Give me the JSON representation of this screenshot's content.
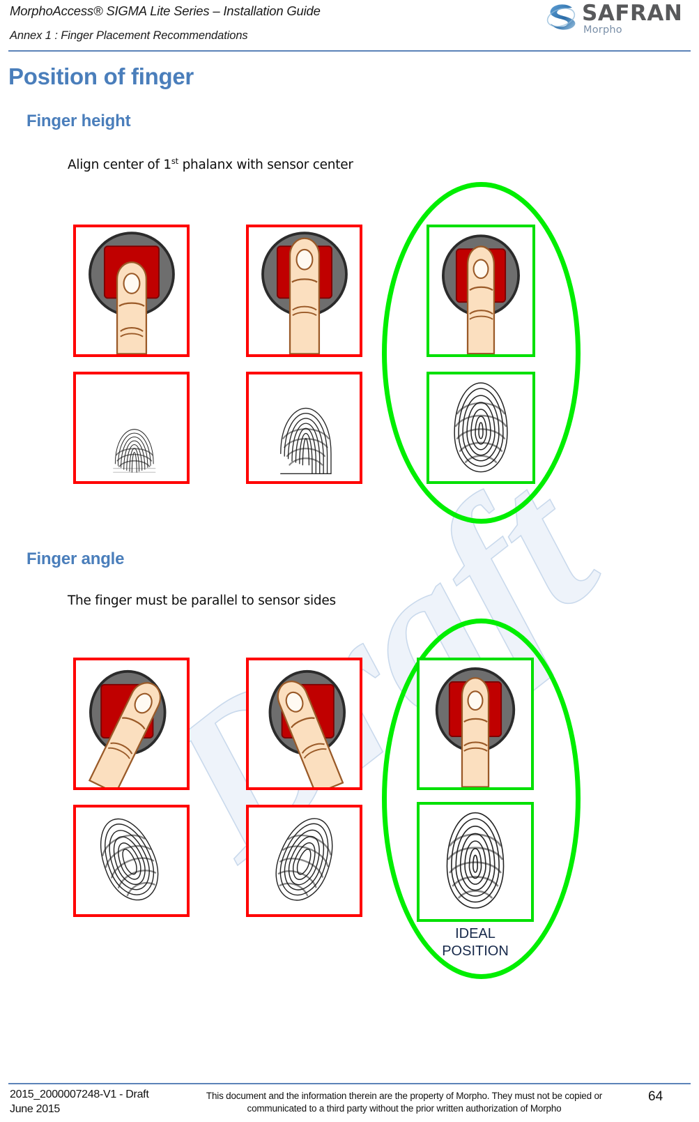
{
  "header": {
    "title": "MorphoAccess® SIGMA Lite Series – Installation Guide",
    "subtitle": "Annex 1 :  Finger Placement Recommendations",
    "logo_word": "SAFRAN",
    "logo_sub": "Morpho"
  },
  "watermark": {
    "text": "Draft"
  },
  "main": {
    "heading": "Position of finger",
    "sections": [
      {
        "heading": "Finger height",
        "instruction_prefix": "Align center of 1",
        "instruction_sup": "st",
        "instruction_suffix": " phalanx with sensor center",
        "columns": [
          {
            "status": "bad",
            "variant": "too-low",
            "print": "partial-small"
          },
          {
            "status": "bad",
            "variant": "too-high",
            "print": "partial-top"
          },
          {
            "status": "good",
            "variant": "centered",
            "print": "full"
          }
        ]
      },
      {
        "heading": "Finger angle",
        "instruction_prefix": "The finger must be parallel to sensor sides",
        "instruction_sup": "",
        "instruction_suffix": "",
        "columns": [
          {
            "status": "bad",
            "variant": "tilt-right",
            "print": "rotated-left"
          },
          {
            "status": "bad",
            "variant": "tilt-left",
            "print": "rotated-right"
          },
          {
            "status": "good",
            "variant": "centered",
            "print": "full"
          }
        ]
      }
    ],
    "ideal_label": "IDEAL\nPOSITION"
  },
  "colors": {
    "heading_blue": "#4a7ebb",
    "rule_blue": "#5b83b8",
    "bad_border": "#ff0000",
    "good_border": "#00e000",
    "ellipse": "#00ee00",
    "ideal_text": "#16284a",
    "sensor_body": "#6e6e6e",
    "sensor_window": "#c00000",
    "skin": "#fbdfbf"
  },
  "footer": {
    "doc_ref": "2015_2000007248-V1 - Draft",
    "doc_date": "June 2015",
    "notice": "This document and the information therein are the property of Morpho. They must not be copied or communicated to a third party without the prior written authorization of Morpho",
    "page": "64"
  }
}
